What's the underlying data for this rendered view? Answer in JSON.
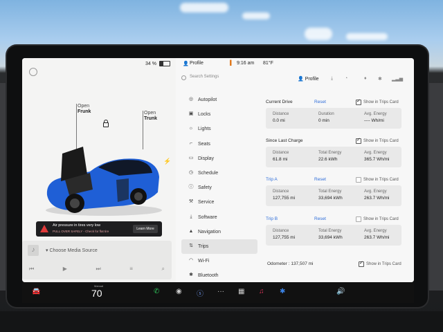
{
  "left": {
    "battery_percent": "34 %",
    "frunk": {
      "line1": "Open",
      "line2": "Frunk"
    },
    "trunk": {
      "line1": "Open",
      "line2": "Trunk"
    },
    "alert": {
      "title": "Air pressure in tires very low",
      "subtitle": "PULL OVER SAFELY - Check for flat tire",
      "button": "Learn More"
    },
    "media": {
      "title": "Choose Media Source"
    }
  },
  "status_bar": {
    "profile": "Profile",
    "time": "9:16 am",
    "temperature": "81°F"
  },
  "header": {
    "search_placeholder": "Search Settings",
    "profile": "Profile"
  },
  "nav": [
    {
      "label": "Autopilot",
      "icon": "steering-wheel-icon"
    },
    {
      "label": "Locks",
      "icon": "lock-icon"
    },
    {
      "label": "Lights",
      "icon": "light-icon"
    },
    {
      "label": "Seats",
      "icon": "seat-icon"
    },
    {
      "label": "Display",
      "icon": "display-icon"
    },
    {
      "label": "Schedule",
      "icon": "clock-icon"
    },
    {
      "label": "Safety",
      "icon": "safety-icon"
    },
    {
      "label": "Service",
      "icon": "wrench-icon"
    },
    {
      "label": "Software",
      "icon": "download-icon"
    },
    {
      "label": "Navigation",
      "icon": "navigation-icon"
    },
    {
      "label": "Trips",
      "icon": "trips-icon",
      "active": true
    },
    {
      "label": "Wi-Fi",
      "icon": "wifi-icon"
    },
    {
      "label": "Bluetooth",
      "icon": "bluetooth-icon"
    }
  ],
  "trips": {
    "current": {
      "title": "Current Drive",
      "reset": "Reset",
      "show": "Show in Trips Card",
      "checked": true,
      "c1_label": "Distance",
      "c1_value": "0.0 mi",
      "c2_label": "Duration",
      "c2_value": "0 min",
      "c3_label": "Avg. Energy",
      "c3_value": "---- Wh/mi"
    },
    "since_charge": {
      "title": "Since Last Charge",
      "show": "Show in Trips Card",
      "checked": true,
      "c1_label": "Distance",
      "c1_value": "61.8 mi",
      "c2_label": "Total Energy",
      "c2_value": "22.6 kWh",
      "c3_label": "Avg. Energy",
      "c3_value": "365.7 Wh/mi"
    },
    "trip_a": {
      "title": "Trip A",
      "reset": "Reset",
      "show": "Show in Trips Card",
      "checked": false,
      "c1_label": "Distance",
      "c1_value": "127,755 mi",
      "c2_label": "Total Energy",
      "c2_value": "33,694 kWh",
      "c3_label": "Avg. Energy",
      "c3_value": "263.7 Wh/mi"
    },
    "trip_b": {
      "title": "Trip B",
      "reset": "Reset",
      "show": "Show in Trips Card",
      "checked": false,
      "c1_label": "Distance",
      "c1_value": "127,755 mi",
      "c2_label": "Total Energy",
      "c2_value": "33,694 kWh",
      "c3_label": "Avg. Energy",
      "c3_value": "263.7 Wh/mi"
    },
    "odometer_label": "Odometer :",
    "odometer_value": "137,507 mi",
    "odometer_show": "Show in Trips Card",
    "odometer_checked": true
  },
  "taskbar": {
    "speed_label": "Manual",
    "speed": "70"
  },
  "colors": {
    "accent": "#2f6ed9",
    "car": "#1f5fd6",
    "alert": "#e03a3a"
  }
}
